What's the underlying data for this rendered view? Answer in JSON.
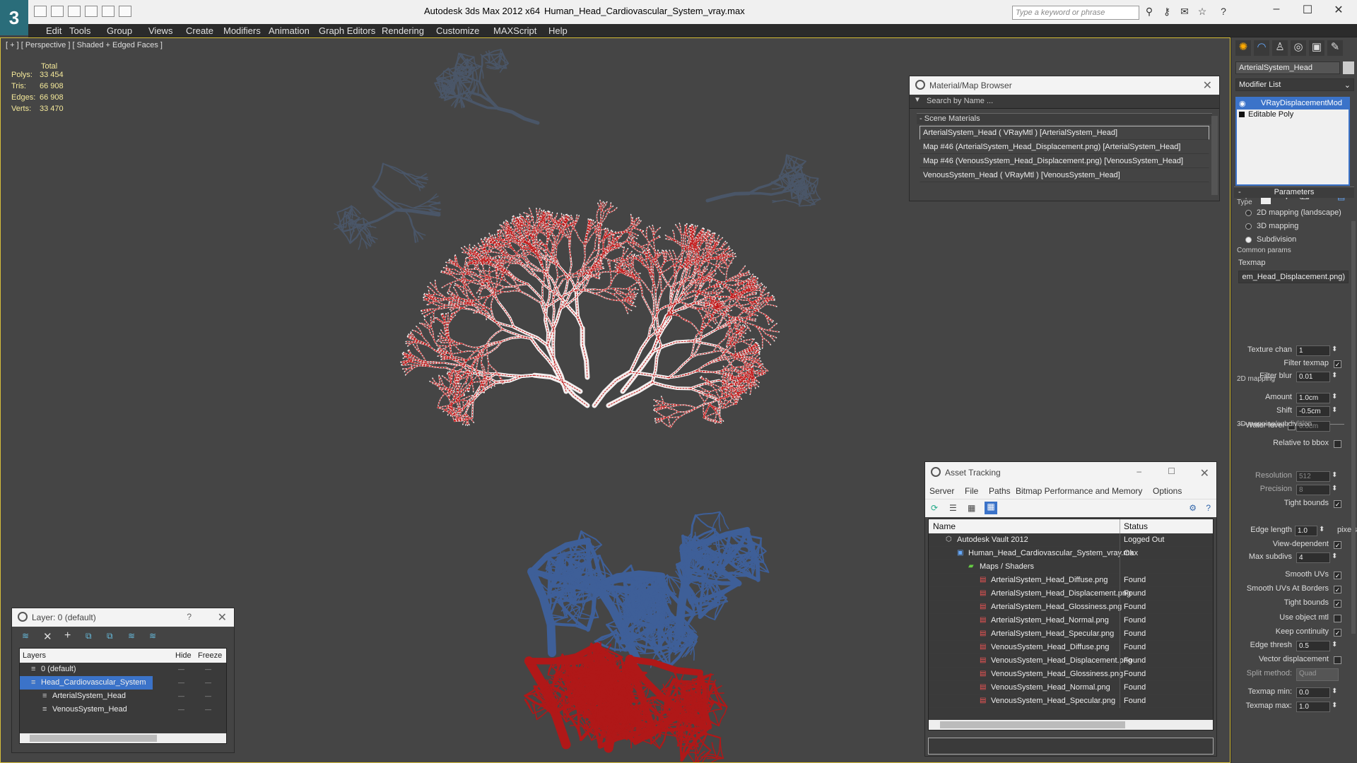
{
  "app": {
    "title": "Autodesk 3ds Max  2012 x64",
    "file": "Human_Head_Cardiovascular_System_vray.max",
    "logo": "3"
  },
  "search": {
    "placeholder": "Type a keyword or phrase"
  },
  "menu": [
    "Edit",
    "Tools",
    "Group",
    "Views",
    "Create",
    "Modifiers",
    "Animation",
    "Graph Editors",
    "Rendering",
    "Customize",
    "MAXScript",
    "Help"
  ],
  "viewport": {
    "label": "[ + ] [ Perspective ] [ Shaded + Edged Faces ]",
    "stats": {
      "header": "Total",
      "rows": [
        {
          "label": "Polys:",
          "value": "33 454"
        },
        {
          "label": "Tris:",
          "value": "66 908"
        },
        {
          "label": "Edges:",
          "value": "66 908"
        },
        {
          "label": "Verts:",
          "value": "33 470"
        }
      ]
    }
  },
  "material_browser": {
    "title": "Material/Map Browser",
    "search": "Search by Name ...",
    "section": "Scene Materials",
    "items": [
      "ArterialSystem_Head  ( VRayMtl ) [ArterialSystem_Head]",
      "Map #46 (ArterialSystem_Head_Displacement.png) [ArterialSystem_Head]",
      "Map #46 (VenousSystem_Head_Displacement.png) [VenousSystem_Head]",
      "VenousSystem_Head  ( VRayMtl ) [VenousSystem_Head]"
    ]
  },
  "layer_panel": {
    "title": "Layer: 0 (default)",
    "help": "?",
    "columns": {
      "name": "Layers",
      "hide": "Hide",
      "freeze": "Freeze"
    },
    "layers": [
      {
        "name": "0 (default)",
        "indent": 0
      },
      {
        "name": "Head_Cardiovascular_System",
        "indent": 0,
        "selected": true
      },
      {
        "name": "ArterialSystem_Head",
        "indent": 1
      },
      {
        "name": "VenousSystem_Head",
        "indent": 1
      }
    ]
  },
  "asset_tracking": {
    "title": "Asset Tracking",
    "menu": [
      "Server",
      "File",
      "Paths",
      "Bitmap Performance and Memory",
      "Options"
    ],
    "columns": {
      "name": "Name",
      "status": "Status"
    },
    "rows": [
      {
        "name": "Autodesk Vault 2012",
        "status": "Logged Out",
        "indent": 0
      },
      {
        "name": "Human_Head_Cardiovascular_System_vray.max",
        "status": "Ok",
        "indent": 1
      },
      {
        "name": "Maps / Shaders",
        "status": "",
        "indent": 2
      },
      {
        "name": "ArterialSystem_Head_Diffuse.png",
        "status": "Found",
        "indent": 3
      },
      {
        "name": "ArterialSystem_Head_Displacement.png",
        "status": "Found",
        "indent": 3
      },
      {
        "name": "ArterialSystem_Head_Glossiness.png",
        "status": "Found",
        "indent": 3
      },
      {
        "name": "ArterialSystem_Head_Normal.png",
        "status": "Found",
        "indent": 3
      },
      {
        "name": "ArterialSystem_Head_Specular.png",
        "status": "Found",
        "indent": 3
      },
      {
        "name": "VenousSystem_Head_Diffuse.png",
        "status": "Found",
        "indent": 3
      },
      {
        "name": "VenousSystem_Head_Displacement.png",
        "status": "Found",
        "indent": 3
      },
      {
        "name": "VenousSystem_Head_Glossiness.png",
        "status": "Found",
        "indent": 3
      },
      {
        "name": "VenousSystem_Head_Normal.png",
        "status": "Found",
        "indent": 3
      },
      {
        "name": "VenousSystem_Head_Specular.png",
        "status": "Found",
        "indent": 3
      }
    ]
  },
  "command_panel": {
    "object_name": "ArterialSystem_Head",
    "modifier_list": "Modifier List",
    "stack": [
      "VRayDisplacementMod",
      "Editable Poly"
    ],
    "rollout": "Parameters",
    "type_label": "Type",
    "types": [
      {
        "label": "2D mapping (landscape)",
        "on": false
      },
      {
        "label": "3D mapping",
        "on": false
      },
      {
        "label": "Subdivision",
        "on": true
      }
    ],
    "common_params": "Common params",
    "texmap_label": "Texmap",
    "texmap": "em_Head_Displacement.png)",
    "texture_chan": {
      "label": "Texture chan",
      "value": "1"
    },
    "filter_texmap": {
      "label": "Filter texmap",
      "checked": true
    },
    "filter_blur": {
      "label": "Filter blur",
      "value": "0.01"
    },
    "amount": {
      "label": "Amount",
      "value": "1.0cm"
    },
    "shift": {
      "label": "Shift",
      "value": "-0.5cm"
    },
    "water_level": {
      "label": "Water level",
      "value": "0.0cm"
    },
    "relative_bbox": {
      "label": "Relative to bbox",
      "checked": false
    },
    "group_2d": "2D mapping",
    "resolution": {
      "label": "Resolution",
      "value": "512"
    },
    "precision": {
      "label": "Precision",
      "value": "8"
    },
    "tight_bounds_2d": {
      "label": "Tight bounds",
      "checked": true
    },
    "group_3d": "3D mapping/subdivision",
    "edge_length": {
      "label": "Edge length",
      "value": "1.0",
      "unit": "pixels"
    },
    "view_dependent": {
      "label": "View-dependent",
      "checked": true
    },
    "max_subdivs": {
      "label": "Max subdivs",
      "value": "4"
    },
    "smooth_uvs": {
      "label": "Smooth UVs",
      "checked": true
    },
    "smooth_uvs_borders": {
      "label": "Smooth UVs At Borders",
      "checked": true
    },
    "tight_bounds_3d": {
      "label": "Tight bounds",
      "checked": true
    },
    "use_object_mtl": {
      "label": "Use object mtl",
      "checked": false
    },
    "keep_continuity": {
      "label": "Keep continuity",
      "checked": true
    },
    "edge_thresh": {
      "label": "Edge thresh",
      "value": "0.5"
    },
    "vector_disp": {
      "label": "Vector displacement",
      "checked": false
    },
    "split_method": {
      "label": "Split method:",
      "value": "Quad"
    },
    "texmap_min": {
      "label": "Texmap min:",
      "value": "0.0"
    },
    "texmap_max": {
      "label": "Texmap max:",
      "value": "1.0"
    }
  },
  "colors": {
    "artery": "#b01818",
    "vein": "#3a5f9a",
    "accent": "#2a6d7a",
    "selection": "#3b73c9"
  }
}
